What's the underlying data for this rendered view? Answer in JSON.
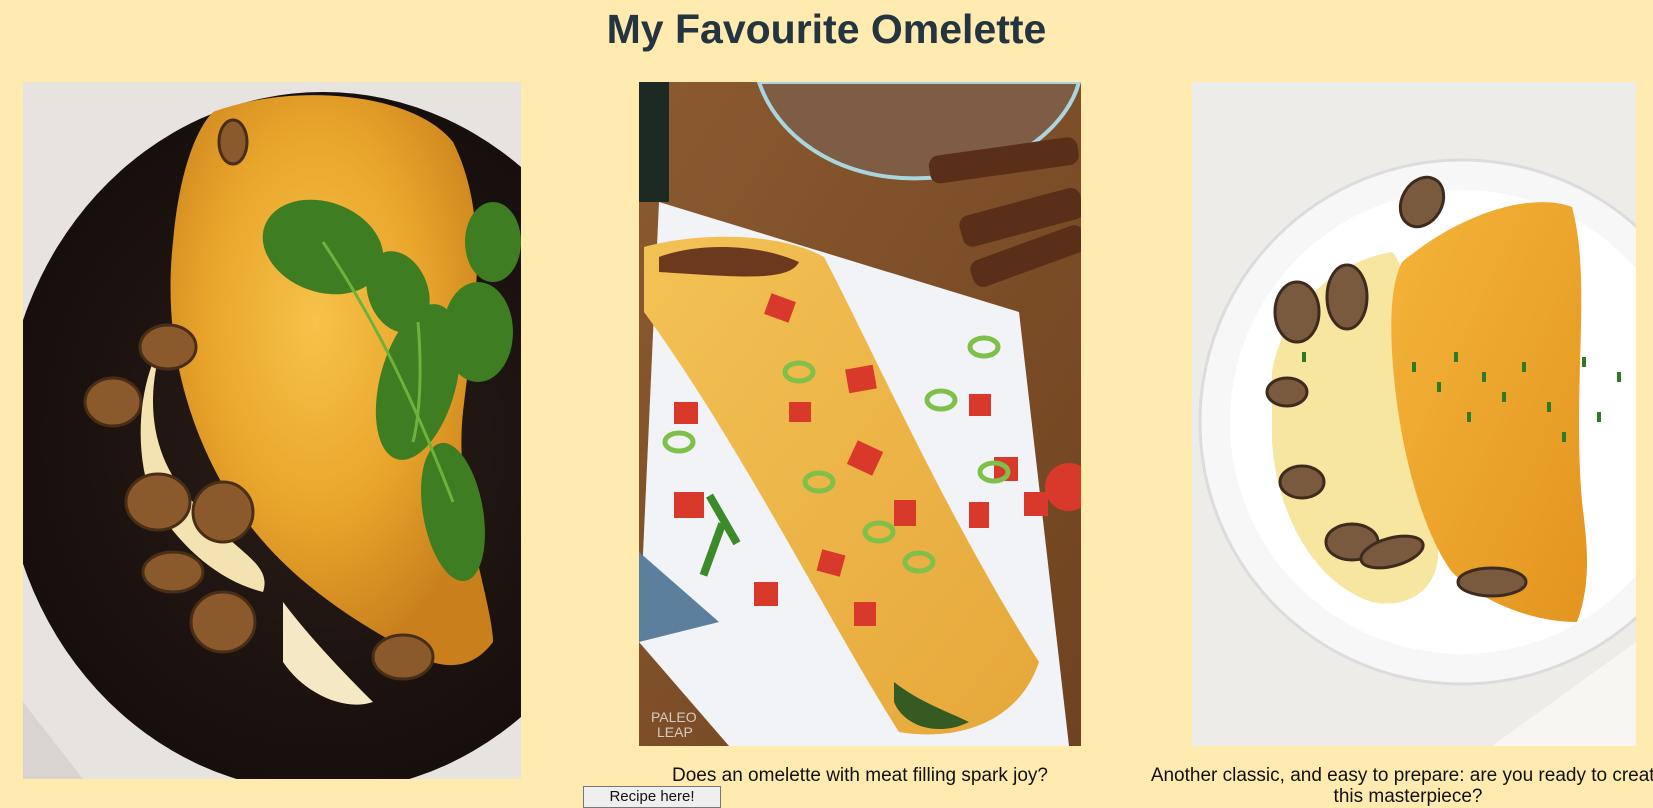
{
  "page": {
    "title": "My Favourite Omelette",
    "background_color": "#ffeab0",
    "title_color": "#243440"
  },
  "cards": [
    {
      "photo_icon": "spinach-mushroom-omelette-photo",
      "caption": ""
    },
    {
      "photo_icon": "meat-filled-omelette-photo",
      "caption": "Does an omelette with meat filling spark joy?",
      "button_label": "Recipe here!"
    },
    {
      "photo_icon": "mushroom-chive-omelette-photo",
      "caption": "Another classic, and easy to prepare: are you ready to create this masterpiece?"
    }
  ]
}
